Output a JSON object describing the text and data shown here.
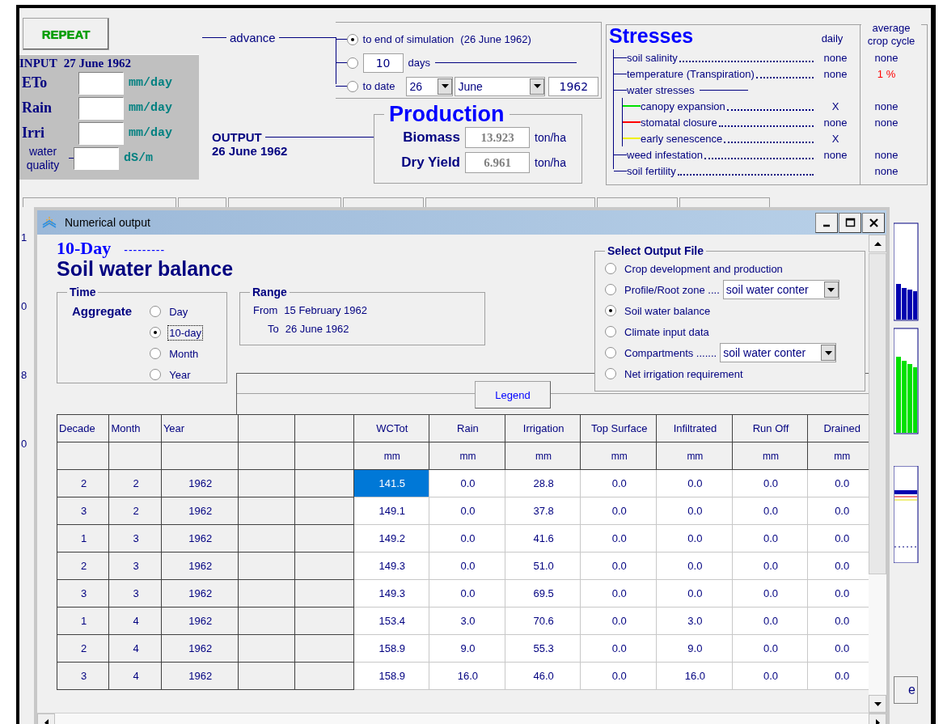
{
  "control_panel": {
    "repeat_button": "REPEAT",
    "advance_label": "advance",
    "advance_options": [
      {
        "kind": "end",
        "label": "to end of simulation",
        "note": "(26 June 1962)",
        "selected": true
      },
      {
        "kind": "days",
        "value": "10",
        "label": "days",
        "selected": false
      },
      {
        "kind": "date",
        "label": "to date",
        "day": "26",
        "month": "June",
        "year": "1962",
        "selected": false
      }
    ]
  },
  "input": {
    "title": "INPUT",
    "date": "27 June 1962",
    "fields": [
      {
        "label": "ETo",
        "unit": "mm/day"
      },
      {
        "label": "Rain",
        "unit": "mm/day"
      },
      {
        "label": "Irri",
        "unit": "mm/day"
      },
      {
        "label": "water quality",
        "unit": "dS/m"
      }
    ]
  },
  "output": {
    "title": "OUTPUT",
    "date": "26 June 1962"
  },
  "production": {
    "title": "Production",
    "items": [
      {
        "label": "Biomass",
        "value": "13.923",
        "unit": "ton/ha"
      },
      {
        "label": "Dry Yield",
        "value": "6.961",
        "unit": "ton/ha"
      }
    ]
  },
  "stresses": {
    "title": "Stresses",
    "daily_header": "daily",
    "average_header": "average crop cycle",
    "rows": [
      {
        "label": "soil salinity",
        "daily": "none",
        "average": "none",
        "warning": false
      },
      {
        "label": "temperature (Transpiration)",
        "daily": "none",
        "average": "1 %",
        "warning": true
      },
      {
        "label": "water stresses",
        "children": [
          {
            "label": "canopy expansion",
            "daily": "X",
            "average": "none",
            "color": "#00e000",
            "warning": false
          },
          {
            "label": "stomatal closure",
            "daily": "none",
            "average": "none",
            "color": "#ff0000",
            "warning": false
          },
          {
            "label": "early senescence",
            "daily": "X",
            "color": "#f0f000"
          }
        ]
      },
      {
        "label": "weed infestation",
        "daily": "none",
        "average": "none",
        "warning": false
      },
      {
        "label": "soil fertility",
        "average": "none",
        "warning": false
      }
    ]
  },
  "edge_labels": [
    "1",
    "0",
    "8",
    "0"
  ],
  "side_button": "e",
  "numerical_output": {
    "title": "Numerical output",
    "period": "10-Day",
    "dashes": "---------",
    "heading": "Soil water balance",
    "time_aggregate": {
      "title": "Time",
      "label": "Aggregate",
      "options": [
        {
          "label": "Day",
          "selected": false
        },
        {
          "label": "10-day",
          "selected": true
        },
        {
          "label": "Month",
          "selected": false
        },
        {
          "label": "Year",
          "selected": false
        }
      ]
    },
    "range": {
      "title": "Range",
      "from_label": "From",
      "from": "15 February 1962",
      "to_label": "To",
      "to": "26 June 1962"
    },
    "output_file": {
      "title": "Select Output File",
      "options": [
        {
          "label": "Crop development and production",
          "selected": false
        },
        {
          "label": "Profile/Root zone ....",
          "dropdown": "soil water conter",
          "selected": false
        },
        {
          "label": "Soil water balance",
          "selected": true
        },
        {
          "label": "Climate input data",
          "selected": false
        },
        {
          "label": "Compartments .......",
          "dropdown": "soil water conter",
          "selected": false
        },
        {
          "label": "Net irrigation requirement",
          "selected": false
        }
      ]
    },
    "legend_button": "Legend",
    "table": {
      "columns": [
        {
          "kind": "key",
          "label": "Decade"
        },
        {
          "kind": "key",
          "label": "Month"
        },
        {
          "kind": "key",
          "label": "Year"
        },
        {
          "kind": "blank"
        },
        {
          "kind": "blank"
        },
        {
          "kind": "value",
          "label": "WCTot",
          "unit": "mm"
        },
        {
          "kind": "value",
          "label": "Rain",
          "unit": "mm"
        },
        {
          "kind": "value",
          "label": "Irrigation",
          "unit": "mm"
        },
        {
          "kind": "value",
          "label": "Top Surface",
          "unit": "mm"
        },
        {
          "kind": "value",
          "label": "Infiltrated",
          "unit": "mm"
        },
        {
          "kind": "value",
          "label": "Run Off",
          "unit": "mm"
        },
        {
          "kind": "value",
          "label": "Drained",
          "unit": "mm"
        }
      ],
      "rows": [
        {
          "cells": [
            "2",
            "2",
            "1962",
            "",
            "",
            "141.5",
            "0.0",
            "28.8",
            "0.0",
            "0.0",
            "0.0",
            "0.0"
          ],
          "selected": true
        },
        {
          "cells": [
            "3",
            "2",
            "1962",
            "",
            "",
            "149.1",
            "0.0",
            "37.8",
            "0.0",
            "0.0",
            "0.0",
            "0.0"
          ],
          "selected": false
        },
        {
          "cells": [
            "1",
            "3",
            "1962",
            "",
            "",
            "149.2",
            "0.0",
            "41.6",
            "0.0",
            "0.0",
            "0.0",
            "0.0"
          ],
          "selected": false
        },
        {
          "cells": [
            "2",
            "3",
            "1962",
            "",
            "",
            "149.3",
            "0.0",
            "51.0",
            "0.0",
            "0.0",
            "0.0",
            "0.0"
          ],
          "selected": false
        },
        {
          "cells": [
            "3",
            "3",
            "1962",
            "",
            "",
            "149.3",
            "0.0",
            "69.5",
            "0.0",
            "0.0",
            "0.0",
            "0.0"
          ],
          "selected": false
        },
        {
          "cells": [
            "1",
            "4",
            "1962",
            "",
            "",
            "153.4",
            "3.0",
            "70.6",
            "0.0",
            "3.0",
            "0.0",
            "0.0"
          ],
          "selected": false
        },
        {
          "cells": [
            "2",
            "4",
            "1962",
            "",
            "",
            "158.9",
            "9.0",
            "55.3",
            "0.0",
            "9.0",
            "0.0",
            "0.0"
          ],
          "selected": false
        },
        {
          "cells": [
            "3",
            "4",
            "1962",
            "",
            "",
            "158.9",
            "16.0",
            "46.0",
            "0.0",
            "16.0",
            "0.0",
            "0.0"
          ],
          "selected": false
        }
      ]
    }
  }
}
